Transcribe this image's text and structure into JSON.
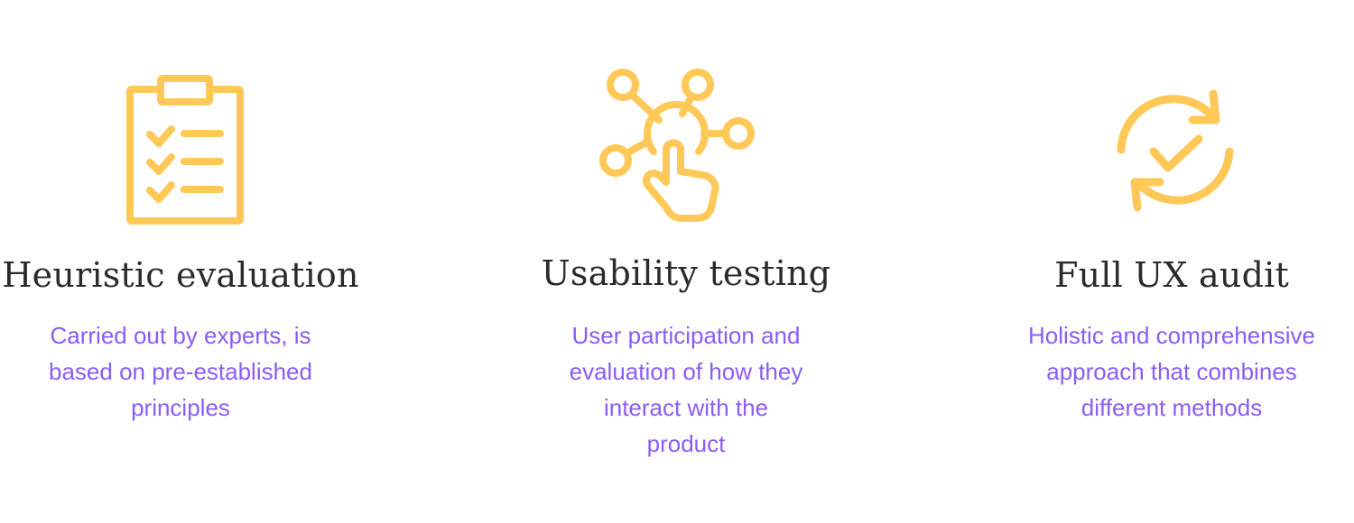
{
  "colors": {
    "icon": "#FFC857",
    "title": "#2B2B2B",
    "description": "#8B5CF6",
    "background": "#FFFFFF"
  },
  "cards": [
    {
      "icon": "clipboard-checklist-icon",
      "title": "Heuristic evaluation",
      "description_lines": [
        "Carried out by experts, is",
        "based on pre-established",
        "principles"
      ]
    },
    {
      "icon": "network-touch-icon",
      "title": "Usability testing",
      "description_lines": [
        "User participation and",
        "evaluation of how they",
        "interact with the",
        "product"
      ]
    },
    {
      "icon": "refresh-check-icon",
      "title": "Full UX audit",
      "description_lines": [
        "Holistic and comprehensive",
        "approach that combines",
        "different methods"
      ]
    }
  ]
}
